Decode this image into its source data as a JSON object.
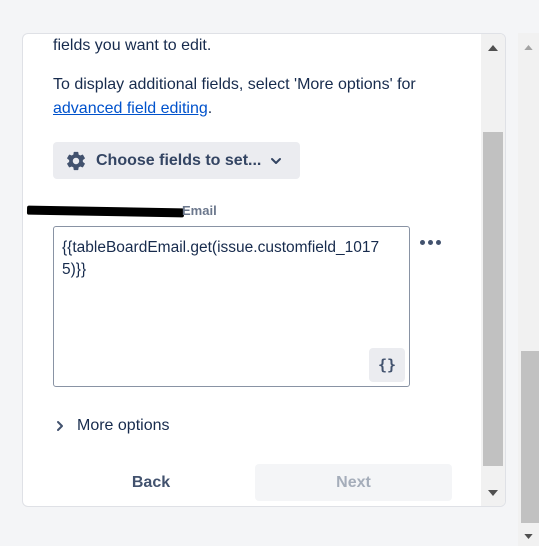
{
  "panel": {
    "intro_line": "fields you want to edit.",
    "info_line": "To display additional fields, select 'More options' for",
    "link_text": "advanced field editing",
    "link_suffix": "."
  },
  "choose_fields": {
    "label": "Choose fields to set...",
    "icon": "gear-icon",
    "chevron_icon": "chevron-down-icon"
  },
  "field": {
    "label": "Email",
    "value": "{{tableBoardEmail.get(issue.customfield_10175)}}",
    "code_button": "{}",
    "more_icon": "more-horizontal-icon"
  },
  "more_options": {
    "label": "More options",
    "icon": "chevron-right-icon"
  },
  "footer": {
    "back_label": "Back",
    "next_label": "Next"
  },
  "colors": {
    "link": "#0052cc",
    "text": "#172b4d",
    "button_bg": "#ebecf0",
    "disabled_text": "#a5adba"
  }
}
